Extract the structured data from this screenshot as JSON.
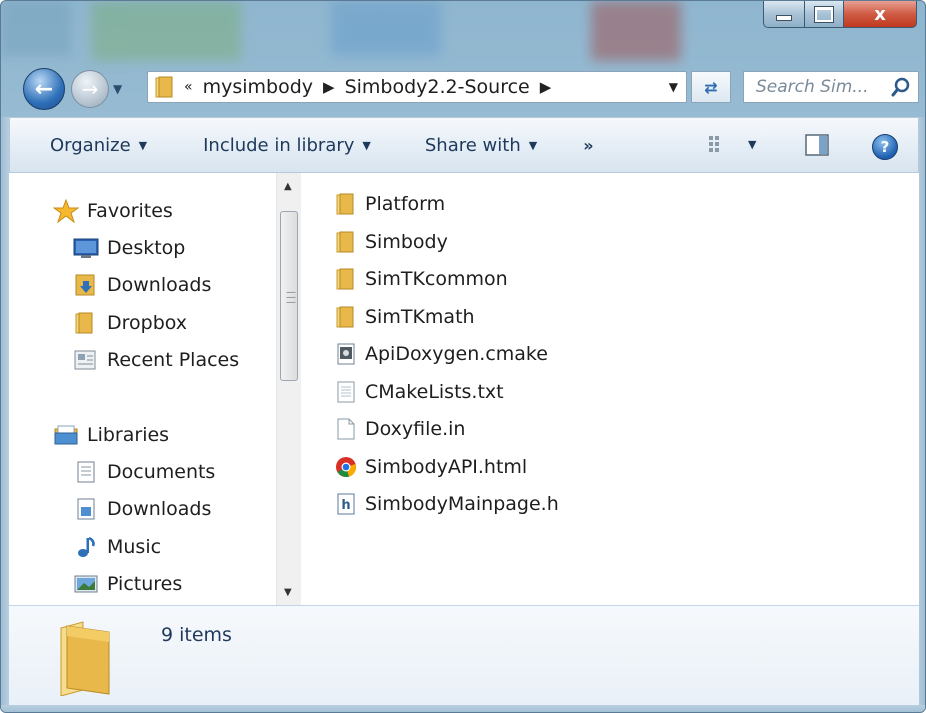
{
  "window": {
    "close_glyph": "x"
  },
  "address": {
    "overflow": "«",
    "crumbs": [
      "mysimbody",
      "Simbody2.2-Source"
    ]
  },
  "search": {
    "placeholder": "Search Sim..."
  },
  "command_bar": {
    "organize": "Organize",
    "include_in_library": "Include in library",
    "share_with": "Share with",
    "more": "»",
    "help": "?"
  },
  "nav_pane": {
    "favorites": {
      "label": "Favorites",
      "items": [
        "Desktop",
        "Downloads",
        "Dropbox",
        "Recent Places"
      ]
    },
    "libraries": {
      "label": "Libraries",
      "items": [
        "Documents",
        "Downloads",
        "Music",
        "Pictures"
      ]
    }
  },
  "files": [
    {
      "name": "Platform",
      "icon": "folder-icon"
    },
    {
      "name": "Simbody",
      "icon": "folder-icon"
    },
    {
      "name": "SimTKcommon",
      "icon": "folder-icon"
    },
    {
      "name": "SimTKmath",
      "icon": "folder-icon"
    },
    {
      "name": "ApiDoxygen.cmake",
      "icon": "cmake-file-icon"
    },
    {
      "name": "CMakeLists.txt",
      "icon": "text-file-icon"
    },
    {
      "name": "Doxyfile.in",
      "icon": "blank-file-icon"
    },
    {
      "name": "SimbodyAPI.html",
      "icon": "chrome-html-file-icon"
    },
    {
      "name": "SimbodyMainpage.h",
      "icon": "header-file-icon"
    }
  ],
  "details": {
    "item_count": "9 items"
  },
  "colors": {
    "folder": "#e8b84a",
    "accent": "#2e6fb8",
    "command_text": "#1e395b"
  }
}
